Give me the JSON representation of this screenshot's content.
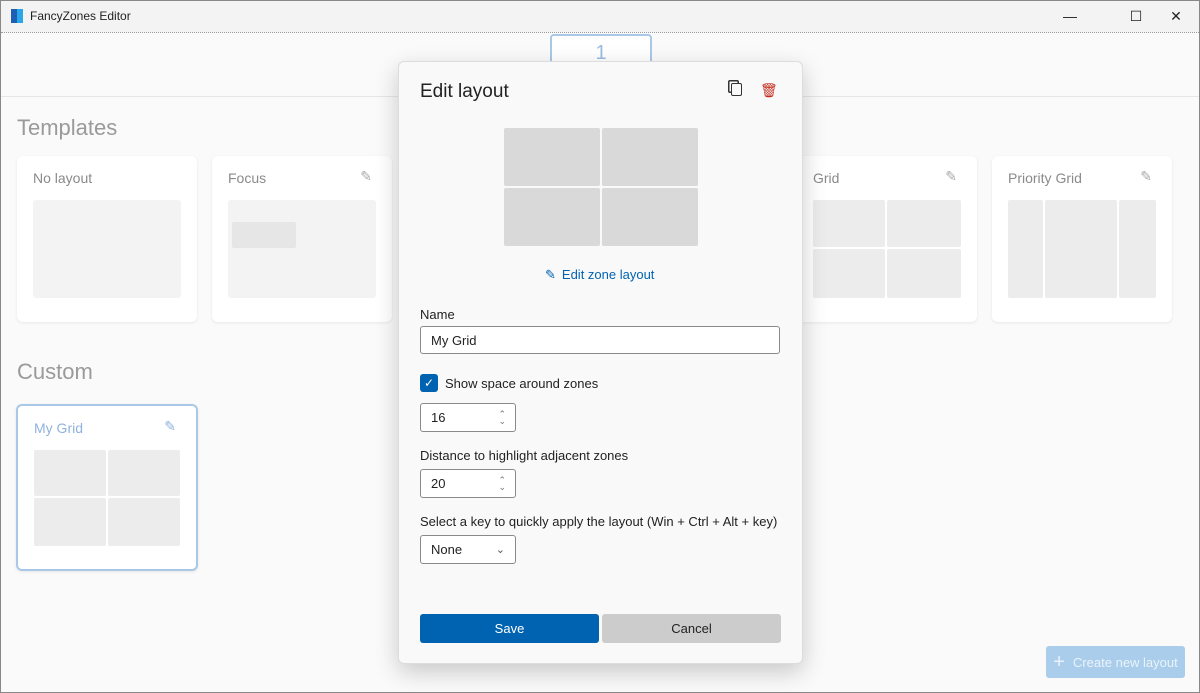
{
  "window": {
    "title": "FancyZones Editor",
    "minimize": "—",
    "maximize": "☐",
    "close": "✕"
  },
  "monitor": {
    "label": "1"
  },
  "templates": {
    "heading": "Templates",
    "items": [
      {
        "label": "No layout"
      },
      {
        "label": "Focus"
      },
      {
        "label": "Grid"
      },
      {
        "label": "Priority Grid"
      }
    ]
  },
  "custom": {
    "heading": "Custom",
    "items": [
      {
        "label": "My Grid"
      }
    ]
  },
  "dialog": {
    "title": "Edit layout",
    "edit_zone_link": "Edit zone layout",
    "name_label": "Name",
    "name_value": "My Grid",
    "space_label": "Show space around zones",
    "space_checked": true,
    "space_value": "16",
    "distance_label": "Distance to highlight adjacent zones",
    "distance_value": "20",
    "key_label": "Select a key to quickly apply the layout (Win + Ctrl + Alt + key)",
    "key_value": "None",
    "save": "Save",
    "cancel": "Cancel"
  },
  "create_button": "Create new layout",
  "colors": {
    "accent": "#0063b1",
    "delete": "#c42b1c"
  }
}
